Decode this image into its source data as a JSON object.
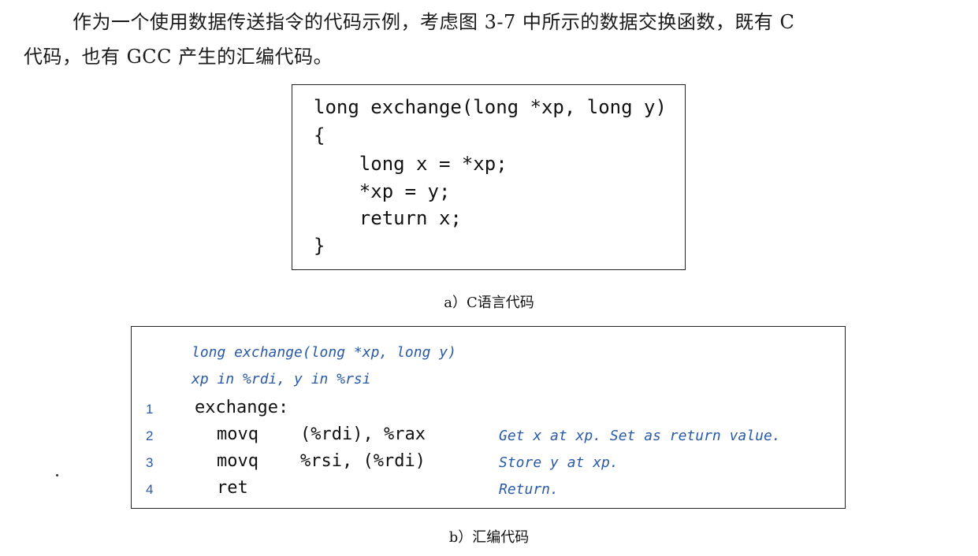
{
  "paragraph": {
    "line1": "作为一个使用数据传送指令的代码示例，考虑图 3-7 中所示的数据交换函数，既有 C",
    "line2": "代码，也有 GCC 产生的汇编代码。"
  },
  "c_code": {
    "lines": [
      "long exchange(long *xp, long y)",
      "{",
      "    long x = *xp;",
      "    *xp = y;",
      "    return x;",
      "}"
    ]
  },
  "caption_a": "a）C语言代码",
  "asm": {
    "header": [
      "long exchange(long *xp, long y)",
      "xp in %rdi, y in %rsi"
    ],
    "rows": [
      {
        "num": "1",
        "instr": "exchange:",
        "operands": "",
        "comment": ""
      },
      {
        "num": "2",
        "instr": "movq",
        "operands": "(%rdi), %rax",
        "comment": "Get x at xp. Set as return value."
      },
      {
        "num": "3",
        "instr": "movq",
        "operands": "%rsi, (%rdi)",
        "comment": "Store y at xp."
      },
      {
        "num": "4",
        "instr": "ret",
        "operands": "",
        "comment": "Return."
      }
    ]
  },
  "caption_b": "b）汇编代码"
}
